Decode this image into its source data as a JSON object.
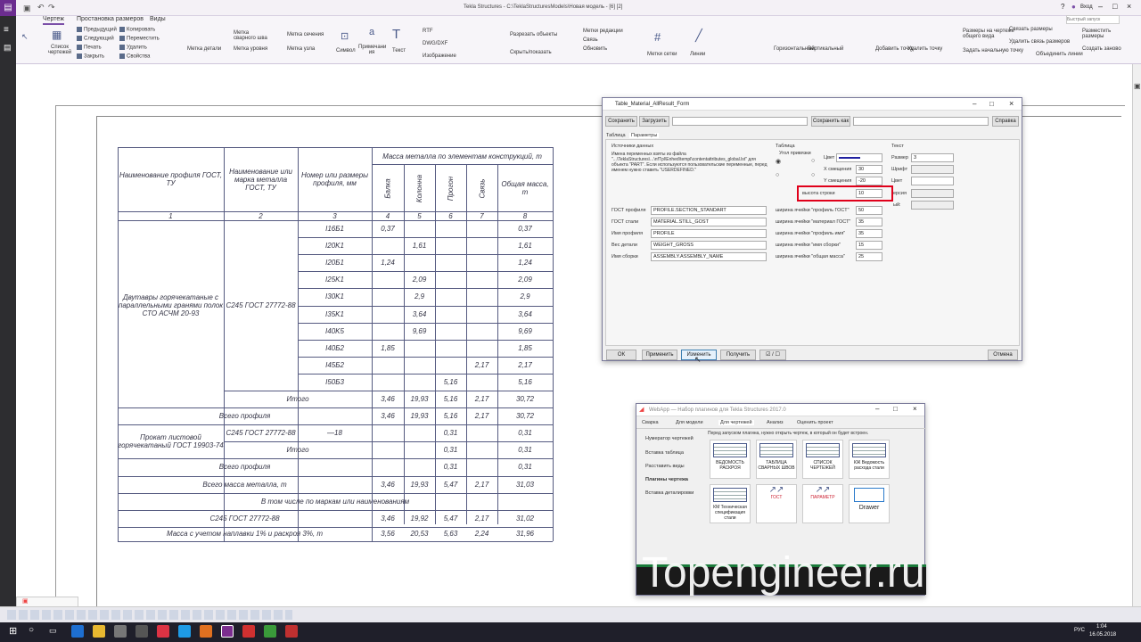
{
  "app": {
    "title": "Tekla Structures - C:\\TeklaStructuresModels\\Новая модель - [6] [2]",
    "login": "Вход",
    "search_placeholder": "Быстрый запуск"
  },
  "tabs": [
    "Чертеж",
    "Простановка размеров",
    "Виды"
  ],
  "ribbon": {
    "list": "Список чертежей",
    "group1": [
      "Предыдущий",
      "Следующий",
      "Печать",
      "Закрыть"
    ],
    "group2": [
      "Копировать",
      "Переместить",
      "Удалить",
      "Свойства"
    ],
    "detail_mark": "Метка детали",
    "weld_mark": "Метка сварного шва",
    "level_mark": "Метка уровня",
    "section_mark": "Метка сечения",
    "node_mark": "Метка узла",
    "symbol": "Символ",
    "note": "Примечани\nия",
    "text": "Текст",
    "rtf": "RTF",
    "dwg": "DWG/DXF",
    "image": "Изображение",
    "g3": [
      "Разрезать объекты",
      "Скрыть/показать"
    ],
    "g4": [
      "Метки редакции",
      "Связь",
      "Обновить"
    ],
    "grid_marks": "Метки сетки",
    "lines": "Линии",
    "horiz": "Горизонтальный",
    "vert": "Вертикальный",
    "add_point": "Добавить точку",
    "del_point": "Удалить точку",
    "dim_gen": "Размеры на чертеже общего вида",
    "g5": [
      "Связать размеры",
      "Удалить связь размеров",
      "Задать начальную точку",
      "Объединить линии"
    ],
    "g6": [
      "Разместить размеры",
      "Создать заново"
    ]
  },
  "table": {
    "headers": {
      "h1": "Наименование профиля ГОСТ, ТУ",
      "h2": "Наименование или марка металла ГОСТ, ТУ",
      "h3": "Номер или размеры профиля, мм",
      "mass": "Масса металла по элементам конструкций, т",
      "c4": "Балка",
      "c5": "Колонна",
      "c6": "Прогон",
      "c7": "Связь",
      "c8": "Общая масса, т"
    },
    "nums": [
      "1",
      "2",
      "3",
      "4",
      "5",
      "6",
      "7",
      "8"
    ],
    "profile1": "Двутавры горячекатаные с параллельными гранями полок СТО АСЧМ 20-93",
    "steel1": "С245 ГОСТ 27772-88",
    "rows": [
      [
        "I16Б1",
        "0,37",
        "",
        "",
        "",
        "0,37"
      ],
      [
        "I20K1",
        "",
        "1,61",
        "",
        "",
        "1,61"
      ],
      [
        "I20Б1",
        "1,24",
        "",
        "",
        "",
        "1,24"
      ],
      [
        "I25K1",
        "",
        "2,09",
        "",
        "",
        "2,09"
      ],
      [
        "I30K1",
        "",
        "2,9",
        "",
        "",
        "2,9"
      ],
      [
        "I35K1",
        "",
        "3,64",
        "",
        "",
        "3,64"
      ],
      [
        "I40K5",
        "",
        "9,69",
        "",
        "",
        "9,69"
      ],
      [
        "I40Б2",
        "1,85",
        "",
        "",
        "",
        "1,85"
      ],
      [
        "I45Б2",
        "",
        "",
        "",
        "2,17",
        "2,17"
      ],
      [
        "I50Б3",
        "",
        "",
        "5,16",
        "",
        "5,16"
      ]
    ],
    "itogo": "Итого",
    "itogo1": [
      "3,46",
      "19,93",
      "5,16",
      "2,17",
      "30,72"
    ],
    "vsego": "Всего профиля",
    "vsego1": [
      "3,46",
      "19,93",
      "5,16",
      "2,17",
      "30,72"
    ],
    "profile2": "Прокат листовой горячекатаный ГОСТ 19903-74",
    "steel2": "С245 ГОСТ 27772-88",
    "size2": "—18",
    "r2": [
      "",
      "",
      "0,31",
      "",
      "0,31"
    ],
    "itogo2": [
      "",
      "",
      "0,31",
      "",
      "0,31"
    ],
    "vsego2": [
      "",
      "",
      "0,31",
      "",
      "0,31"
    ],
    "total_label": "Всего масса металла, т",
    "total": [
      "3,46",
      "19,93",
      "5,47",
      "2,17",
      "31,03"
    ],
    "incl": "В том числе по маркам или наименованиям",
    "steel_row": "С245 ГОСТ 27772-88",
    "steel_vals": [
      "3,46",
      "19,92",
      "5,47",
      "2,17",
      "31,02"
    ],
    "with_label": "Масса с учетом наплавки 1% и раскроя 3%, т",
    "with_vals": [
      "3,56",
      "20,53",
      "5,63",
      "2,24",
      "31,96"
    ]
  },
  "dialog": {
    "title": "Table_Material_AllResult_Form",
    "save": "Сохранить",
    "load": "Загрузить",
    "save_as": "Сохранить как",
    "help": "Справка",
    "tab1": "Таблица",
    "tab2": "Параметры",
    "src_title": "Источники данных",
    "src_text": "Имена переменных взяты из файла \"...\\TeklaStructures\\...\\nfTpl\\Enhed\\templ\\contentattributes_global.lst\" для объекта \"PART\". Если используются пользовательские переменные, перед именем нужно ставить \"USERDEFINED.\"",
    "f1": "ГОСТ профиля",
    "v1": "PROFILE.SECTION_STANDART",
    "f2": "ГОСТ стали",
    "v2": "MATERIAL.STILL_GOST",
    "f3": "Имя профиля",
    "v3": "PROFILE",
    "f4": "Вес детали",
    "v4": "WEIGHT_GROSS",
    "f5": "Имя сборки",
    "v5": "ASSEMBLY.ASSEMBLY_NAME",
    "tbl": "Таблица",
    "corner": "Угол привязки",
    "color": "Цвет",
    "xoff": "Х смещения",
    "xv": "30",
    "yoff": "Y смещения",
    "yv": "-20",
    "rowh": "высота строки",
    "rowhv": "10",
    "w1": "ширина ячейки \"профиль ГОСТ\"",
    "wv1": "50",
    "w2": "ширина ячейки \"материал ГОСТ\"",
    "wv2": "35",
    "w3": "ширина ячейки \"профиль имя\"",
    "wv3": "35",
    "w4": "ширина ячейки \"имя сборки\"",
    "wv4": "15",
    "w5": "ширина ячейки \"общая масса\"",
    "wv5": "25",
    "text_title": "Текст",
    "size": "Размер",
    "sizev": "3",
    "font": "Шрифт",
    "tcolor": "Цвет",
    "s1": "ерсия",
    "s2": "ый:",
    "ok": "ОК",
    "apply": "Применить",
    "modify": "Изменить",
    "get": "Получить",
    "toggle": "☑ / ☐",
    "cancel": "Отмена"
  },
  "webapp": {
    "title": "WebApp — Набор плагинов для Tekla Structures 2017.0",
    "tabs": [
      "Сварка",
      "Для модели",
      "Для чертежей",
      "Анализ",
      "Оценить проект"
    ],
    "hint": "Перед запуском плагина, нужно открыть чертеж, в который он будет встроен.",
    "side": [
      "Нумератор чертежей",
      "Вставка таблица",
      "Расставить виды",
      "Плагины чертежа",
      "Вставка деталировки"
    ],
    "plugins": [
      "ВЕДОМОСТЬ РАСКРОЯ",
      "ТАБЛИЦА СВАРНЫХ ШВОВ",
      "СПИСОК ЧЕРТЕЖЕЙ",
      "КЖ Ведомость расхода стали",
      "КМ Техническая спецификация стали",
      "ГОСТ",
      "ПАРАМЕТР",
      "Drawer"
    ]
  },
  "watermark": "Topengineer.ru",
  "clock": {
    "time": "1:04",
    "date": "16.05.2018",
    "lang": "РУС"
  },
  "colors": {
    "accent": "#7b4fa8",
    "table_line": "#555a80",
    "highlight": "#e0001a"
  }
}
